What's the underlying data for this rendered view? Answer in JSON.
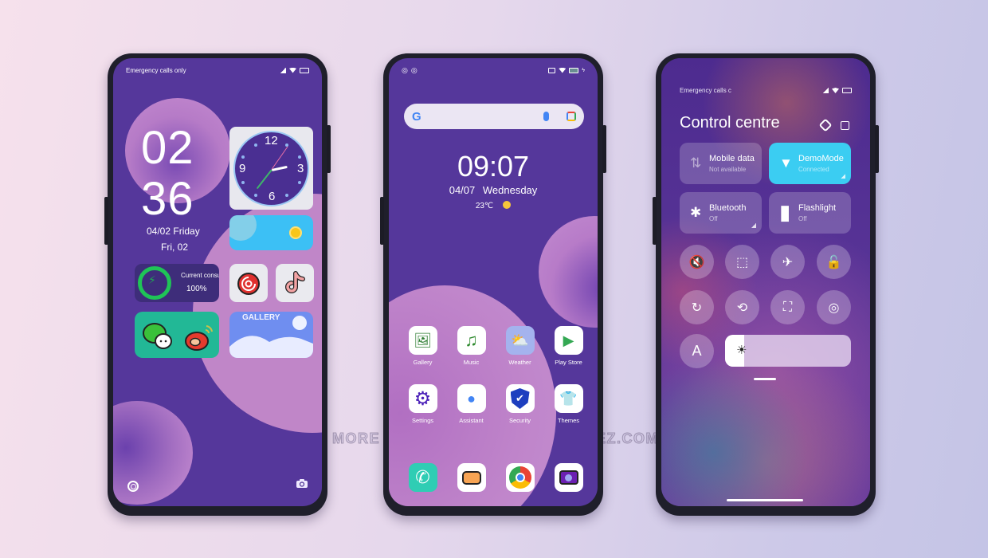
{
  "watermark": "FOR MORE THEMES VISIT - MIUITHEMEZ.COM",
  "phone1": {
    "status_text": "Emergency calls only",
    "clock_hour": "02",
    "clock_minute": "36",
    "date_line1": "04/02 Friday",
    "date_line2": "Fri, 02",
    "analog_clock": {
      "numbers": [
        "12",
        "3",
        "6",
        "9"
      ]
    },
    "battery_widget": {
      "label": "Current consum",
      "percent": "100%",
      "level": 1.0
    },
    "gallery_widget_title": "GALLERY",
    "icons": [
      "netease-music-icon",
      "tiktok-icon",
      "wechat-icon",
      "weibo-icon"
    ]
  },
  "phone2": {
    "search_logo": "G",
    "time": "09:07",
    "date": "04/07 Wednesday",
    "temperature": "23℃",
    "apps_row1": [
      {
        "label": "Gallery",
        "icon": "🖼"
      },
      {
        "label": "Music",
        "icon": "♫"
      },
      {
        "label": "Weather",
        "icon": "⛅"
      },
      {
        "label": "Play Store",
        "icon": "▶"
      }
    ],
    "apps_row2": [
      {
        "label": "Settings",
        "icon": "⚙"
      },
      {
        "label": "Assistant",
        "icon": "●"
      },
      {
        "label": "Security",
        "icon": "✔"
      },
      {
        "label": "Themes",
        "icon": "👕"
      }
    ],
    "dock": [
      {
        "label": "Phone",
        "icon": "✆"
      },
      {
        "label": "Messages",
        "icon": "💬"
      },
      {
        "label": "Chrome",
        "icon": "◉"
      },
      {
        "label": "Camera",
        "icon": "📷"
      }
    ]
  },
  "phone3": {
    "status_text": "Emergency calls c",
    "title": "Control centre",
    "tiles": {
      "mobile": {
        "name": "Mobile data",
        "status": "Not available",
        "icon": "⇅"
      },
      "wifi": {
        "name": "DemoMode",
        "status": "Connected",
        "icon": "▼"
      },
      "bluetooth": {
        "name": "Bluetooth",
        "status": "Off",
        "icon": "✱"
      },
      "flashlight": {
        "name": "Flashlight",
        "status": "Off",
        "icon": "▮"
      }
    },
    "toggles": [
      {
        "name": "mute",
        "glyph": "🔇"
      },
      {
        "name": "screenshot",
        "glyph": "⬚"
      },
      {
        "name": "airplane",
        "glyph": "✈"
      },
      {
        "name": "lock",
        "glyph": "🔓"
      },
      {
        "name": "auto-rotate-off",
        "glyph": "↻"
      },
      {
        "name": "rotation-lock",
        "glyph": "⟲"
      },
      {
        "name": "scanner",
        "glyph": "⛶"
      },
      {
        "name": "reading-mode",
        "glyph": "◎"
      }
    ],
    "auto_brightness_label": "A",
    "brightness_level": 0.15,
    "brightness_icon": "☀"
  }
}
